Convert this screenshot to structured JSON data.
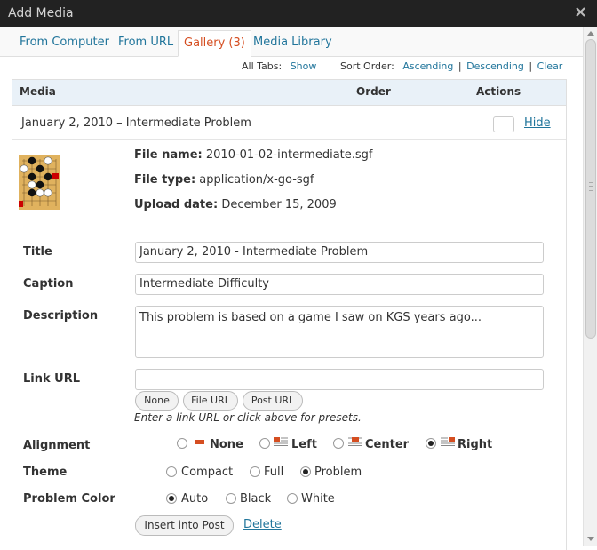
{
  "window": {
    "title": "Add Media"
  },
  "tabs": [
    {
      "label": "From Computer",
      "active": false
    },
    {
      "label": "From URL",
      "active": false
    },
    {
      "label": "Gallery (3)",
      "active": true
    },
    {
      "label": "Media Library",
      "active": false
    }
  ],
  "sortbar": {
    "all_tabs_label": "All Tabs:",
    "show": "Show",
    "sort_label": "Sort Order:",
    "ascending": "Ascending",
    "sep": "|",
    "descending": "Descending",
    "clear": "Clear"
  },
  "table": {
    "col_media": "Media",
    "col_order": "Order",
    "col_actions": "Actions"
  },
  "item": {
    "title": "January 2, 2010 – Intermediate Problem",
    "hide": "Hide",
    "file_name_label": "File name:",
    "file_name": "2010-01-02-intermediate.sgf",
    "file_type_label": "File type:",
    "file_type": "application/x-go-sgf",
    "upload_date_label": "Upload date:",
    "upload_date": "December 15, 2009"
  },
  "form": {
    "title_label": "Title",
    "title_value": "January 2, 2010 - Intermediate Problem",
    "caption_label": "Caption",
    "caption_value": "Intermediate Difficulty",
    "description_label": "Description",
    "description_value": "This problem is based on a game I saw on KGS years ago...",
    "link_url_label": "Link URL",
    "link_url_value": "",
    "btn_none": "None",
    "btn_file_url": "File URL",
    "btn_post_url": "Post URL",
    "link_help": "Enter a link URL or click above for presets.",
    "alignment_label": "Alignment",
    "alignment_options": [
      "None",
      "Left",
      "Center",
      "Right"
    ],
    "alignment_selected": "Right",
    "theme_label": "Theme",
    "theme_options": [
      "Compact",
      "Full",
      "Problem"
    ],
    "theme_selected": "Problem",
    "color_label": "Problem Color",
    "color_options": [
      "Auto",
      "Black",
      "White"
    ],
    "color_selected": "Auto",
    "insert_button": "Insert into Post",
    "delete_link": "Delete"
  },
  "colors": {
    "link": "#21759b",
    "active_tab": "#d54e21",
    "titlebar": "#222222",
    "header_bg": "#e9f1f8"
  }
}
